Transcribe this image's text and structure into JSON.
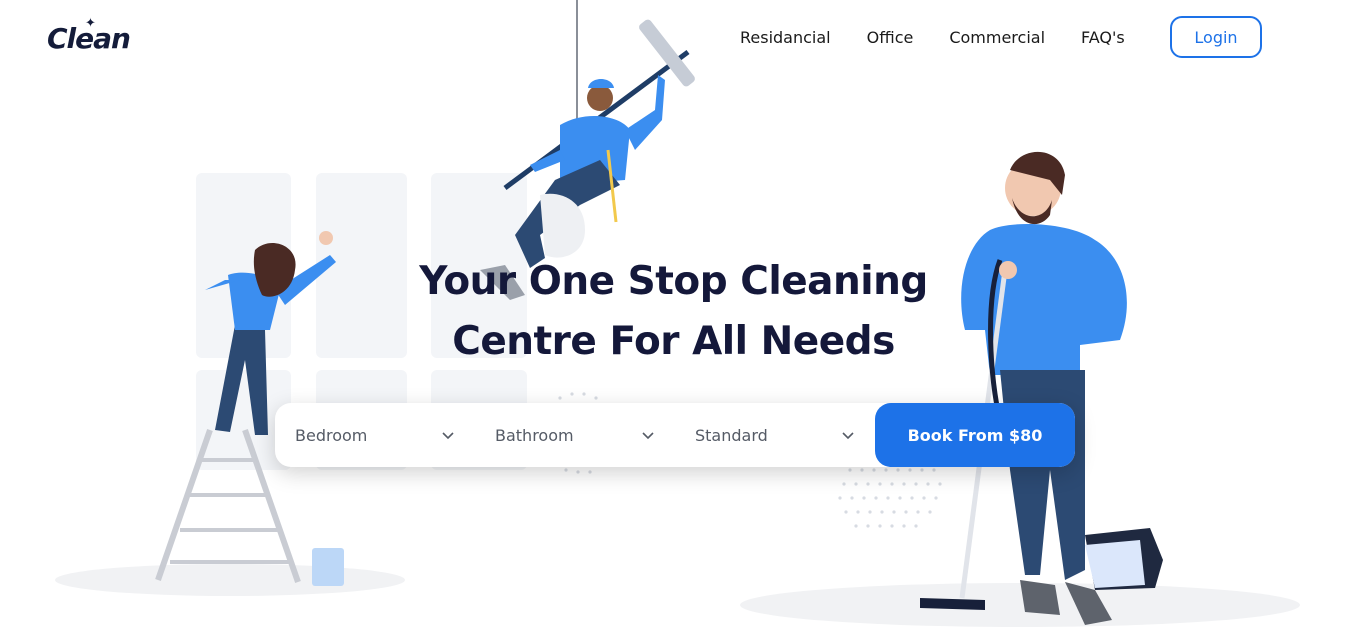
{
  "brand": {
    "logo_text": "Clean"
  },
  "nav": {
    "items": [
      {
        "label": "Residancial"
      },
      {
        "label": "Office"
      },
      {
        "label": "Commercial"
      },
      {
        "label": "FAQ's"
      }
    ],
    "login_label": "Login"
  },
  "hero": {
    "title_line1": "Your One Stop Cleaning",
    "title_line2": "Centre For All Needs"
  },
  "booking": {
    "bedroom": "Bedroom",
    "bathroom": "Bathroom",
    "service": "Standard",
    "book_label": "Book From $80"
  },
  "colors": {
    "accent": "#1d72e8",
    "heading": "#14183a",
    "illustration_blue": "#3b8ef0"
  },
  "icons": [
    "chevron-down-icon",
    "sparkle-icon"
  ]
}
